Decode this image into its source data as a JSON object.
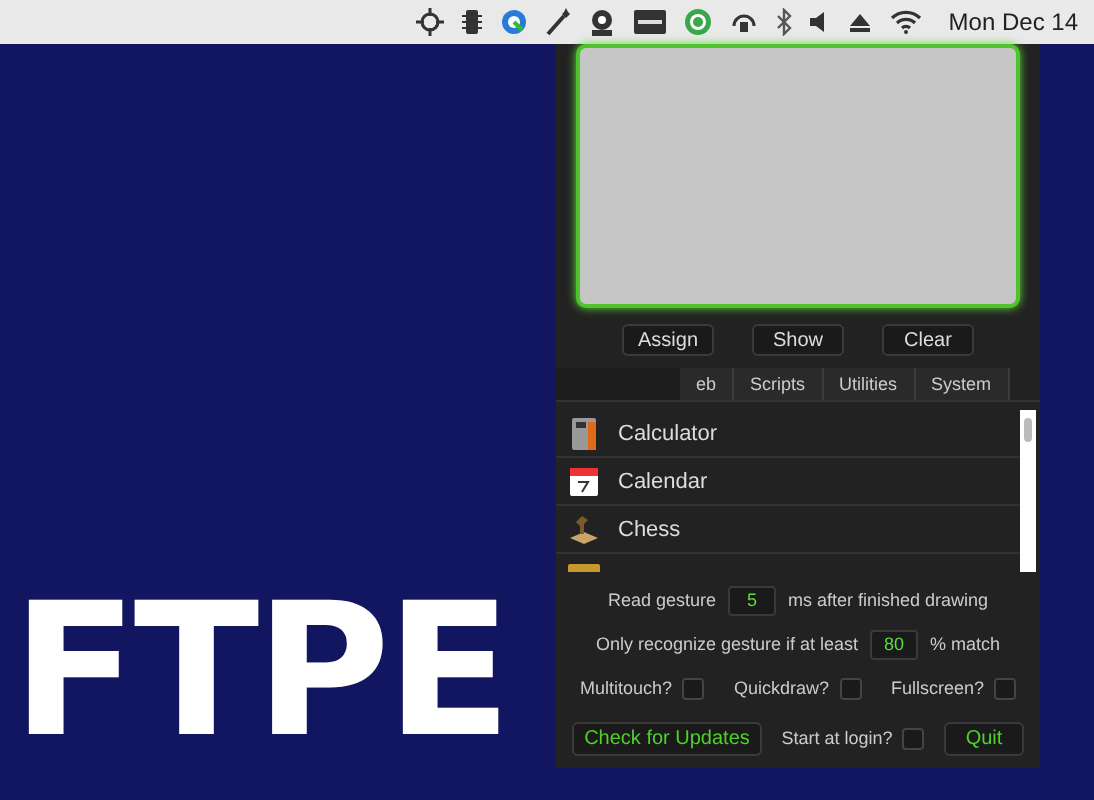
{
  "menu_bar": {
    "clock": "Mon Dec 14"
  },
  "desktop": {
    "wallpaper_text": "FTPE"
  },
  "gesture_panel": {
    "buttons": [
      "Assign",
      "Show",
      "Clear"
    ],
    "tabs": [
      {
        "label": "eb",
        "selected": false
      },
      {
        "label": "Scripts",
        "selected": false
      },
      {
        "label": "Utilities",
        "selected": false
      },
      {
        "label": "System",
        "selected": false
      }
    ],
    "apps": [
      {
        "name": "Calculator",
        "kind": "calculator"
      },
      {
        "name": "Calendar",
        "kind": "calendar"
      },
      {
        "name": "Chess",
        "kind": "chess"
      },
      {
        "kind": "folder"
      }
    ],
    "settings": {
      "read_gesture": {
        "before": "Read gesture",
        "value": "5",
        "after": "ms after finished drawing"
      },
      "match": {
        "before": "Only recognize gesture if at least",
        "value": "80",
        "after": "% match"
      },
      "checkboxes": [
        {
          "label": "Multitouch?",
          "checked": false
        },
        {
          "label": "Quickdraw?",
          "checked": false
        },
        {
          "label": "Fullscreen?",
          "checked": false
        }
      ],
      "update_button": "Check for Updates",
      "login": {
        "label": "Start at login?",
        "checked": false
      },
      "quit_button": "Quit"
    }
  }
}
